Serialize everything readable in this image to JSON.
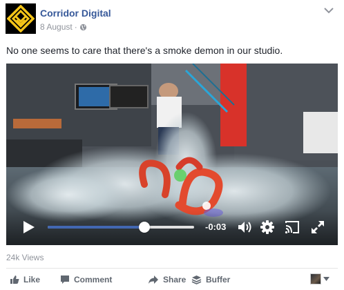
{
  "post": {
    "author": "Corridor Digital",
    "date": "8 August",
    "separator": "·",
    "privacy_icon": "globe-icon",
    "text": "No one seems to care that there's a smoke demon in our studio."
  },
  "video": {
    "time_remaining": "-0:03",
    "progress": 0.66,
    "icons": [
      "play-icon",
      "volume-icon",
      "settings-gear-icon",
      "cast-icon",
      "fullscreen-icon"
    ],
    "accent_color": "#4267b2"
  },
  "stats": {
    "views": "24k Views"
  },
  "actions": {
    "like_label": "Like",
    "comment_label": "Comment",
    "share_label": "Share",
    "buffer_label": "Buffer"
  },
  "colors": {
    "author_link": "#365899",
    "meta_text": "#90949c",
    "logo_yellow": "#f5c518"
  }
}
